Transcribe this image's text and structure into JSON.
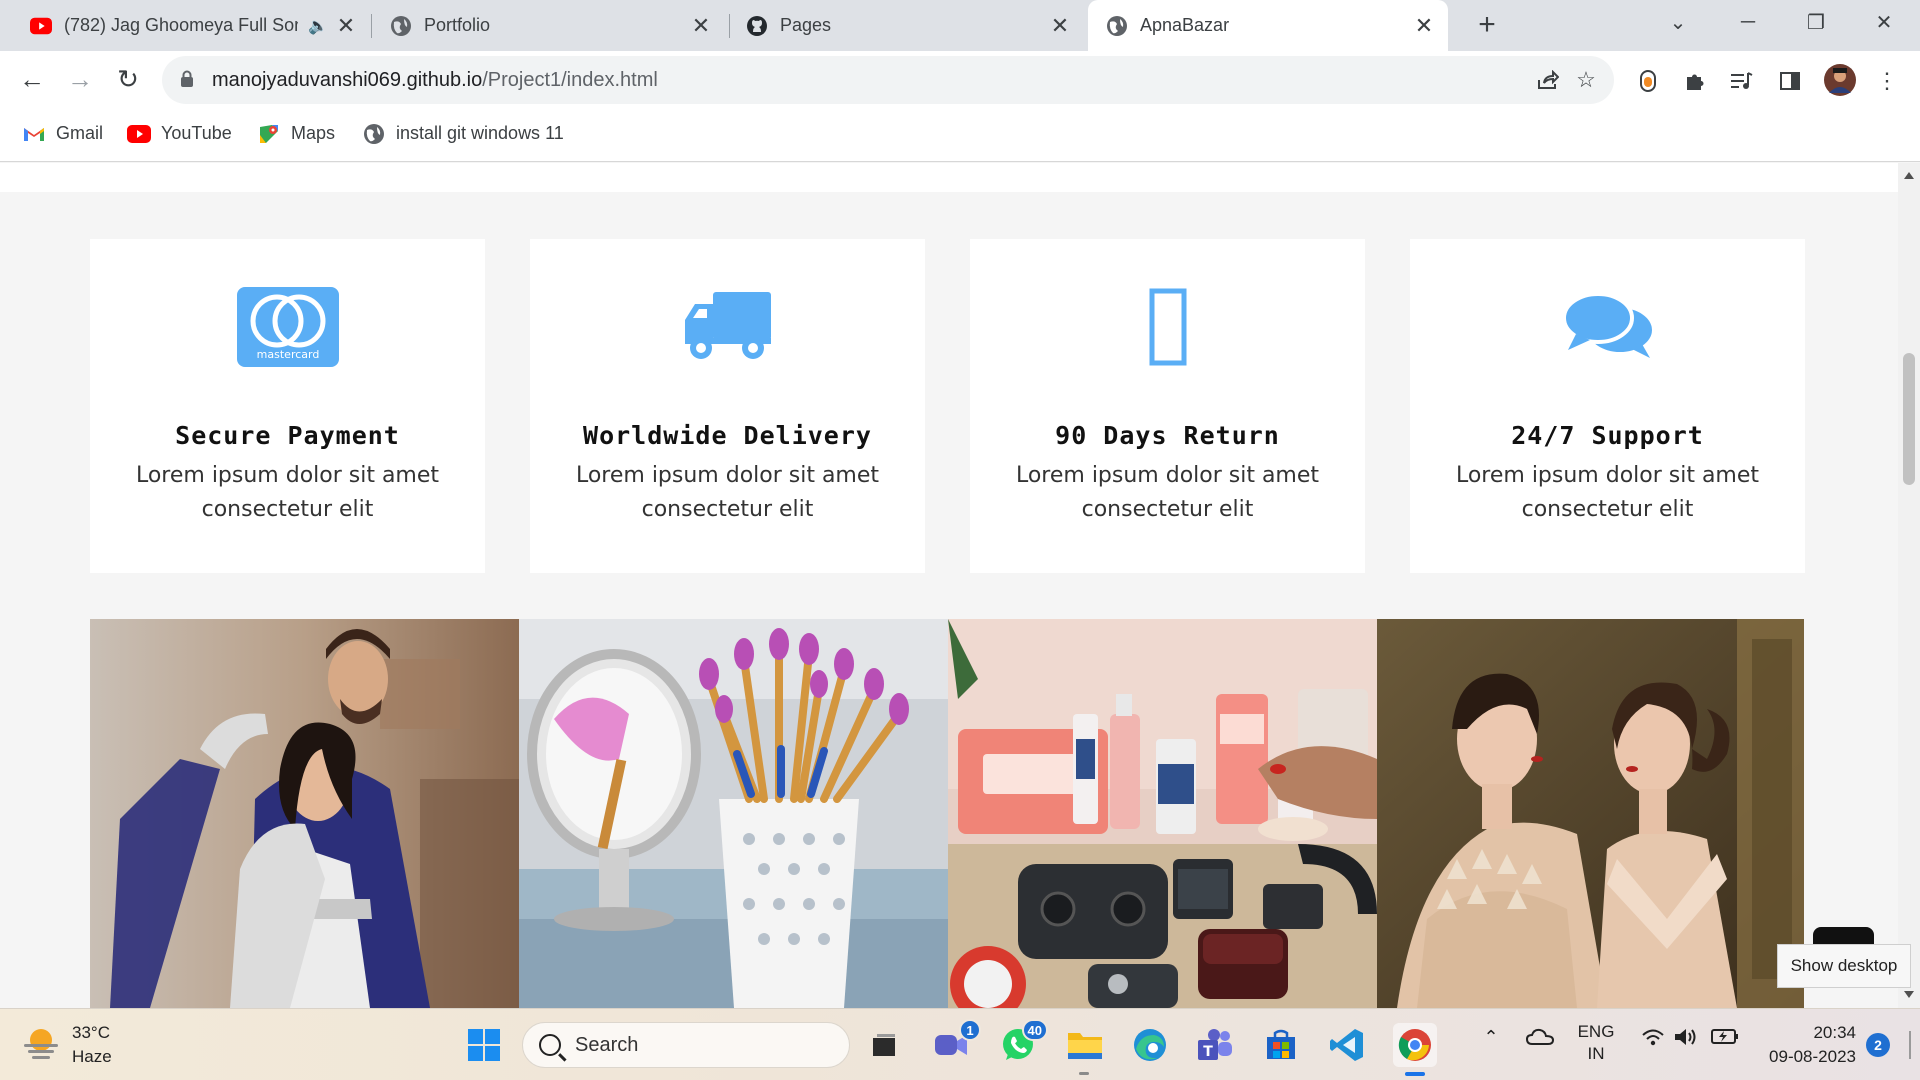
{
  "browser": {
    "tabs": [
      {
        "title": "(782) Jag Ghoomeya Full Son",
        "icon": "youtube-icon",
        "muted_icon": "speaker-icon"
      },
      {
        "title": "Portfolio",
        "icon": "globe-icon"
      },
      {
        "title": "Pages",
        "icon": "github-icon"
      },
      {
        "title": "ApnaBazar",
        "icon": "globe-icon",
        "active": true
      }
    ],
    "url_host": "manojyaduvanshi069.github.io",
    "url_path": "/Project1/index.html",
    "bookmarks": [
      {
        "label": "Gmail",
        "icon": "gmail-icon"
      },
      {
        "label": "YouTube",
        "icon": "youtube-icon"
      },
      {
        "label": "Maps",
        "icon": "maps-icon"
      },
      {
        "label": "install git windows 11",
        "icon": "globe-icon"
      }
    ]
  },
  "page": {
    "features": [
      {
        "title": "Secure Payment",
        "desc": "Lorem ipsum dolor sit amet consectetur elit",
        "icon": "mastercard-icon"
      },
      {
        "title": "Worldwide Delivery",
        "desc": "Lorem ipsum dolor sit amet consectetur elit",
        "icon": "truck-icon"
      },
      {
        "title": "90 Days Return",
        "desc": "Lorem ipsum dolor sit amet consectetur elit",
        "icon": "missing-glyph-icon"
      },
      {
        "title": "24/7 Support",
        "desc": "Lorem ipsum dolor sit amet consectetur elit",
        "icon": "chat-icon"
      }
    ],
    "mastercard_label": "mastercard",
    "accent": "#5aaef5"
  },
  "tooltip": "Show desktop",
  "taskbar": {
    "temp": "33°C",
    "condition": "Haze",
    "search_placeholder": "Search",
    "badges": {
      "meet": "1",
      "whatsapp": "40"
    },
    "lang_top": "ENG",
    "lang_bottom": "IN",
    "time": "20:34",
    "date": "09-08-2023",
    "notifications": "2"
  }
}
